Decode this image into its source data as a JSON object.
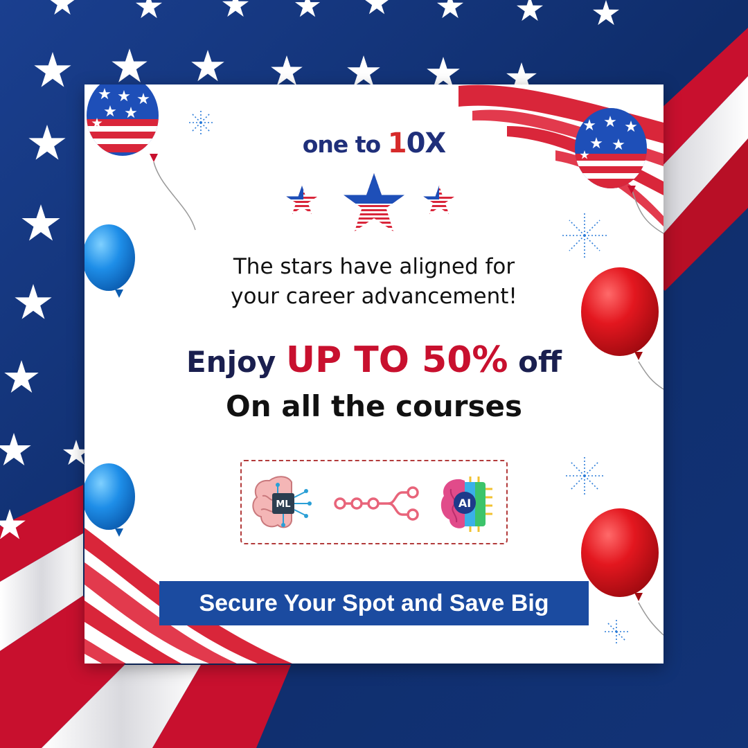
{
  "brand": {
    "name_prefix": "one to ",
    "name_ten_one": "1",
    "name_ten_zero": "0",
    "name_suffix": "X"
  },
  "headline": {
    "line1": "The stars have aligned for",
    "line2": "your career advancement!"
  },
  "offer": {
    "prefix": "Enjoy ",
    "highlight": "UP TO 50%",
    "suffix": " off",
    "subline": "On all the courses"
  },
  "courses": [
    {
      "icon": "ml-brain-icon",
      "label": "ML"
    },
    {
      "icon": "workflow-nodes-icon",
      "label": ""
    },
    {
      "icon": "ai-brain-chip-icon",
      "label": "AI"
    }
  ],
  "cta": {
    "label": "Secure Your Spot and Save Big"
  },
  "colors": {
    "navy": "#0f2d6b",
    "flag_red": "#c8102e",
    "cta_blue": "#1b4ba0",
    "balloon_red": "#e3171f",
    "balloon_blue": "#1e8ee8"
  }
}
